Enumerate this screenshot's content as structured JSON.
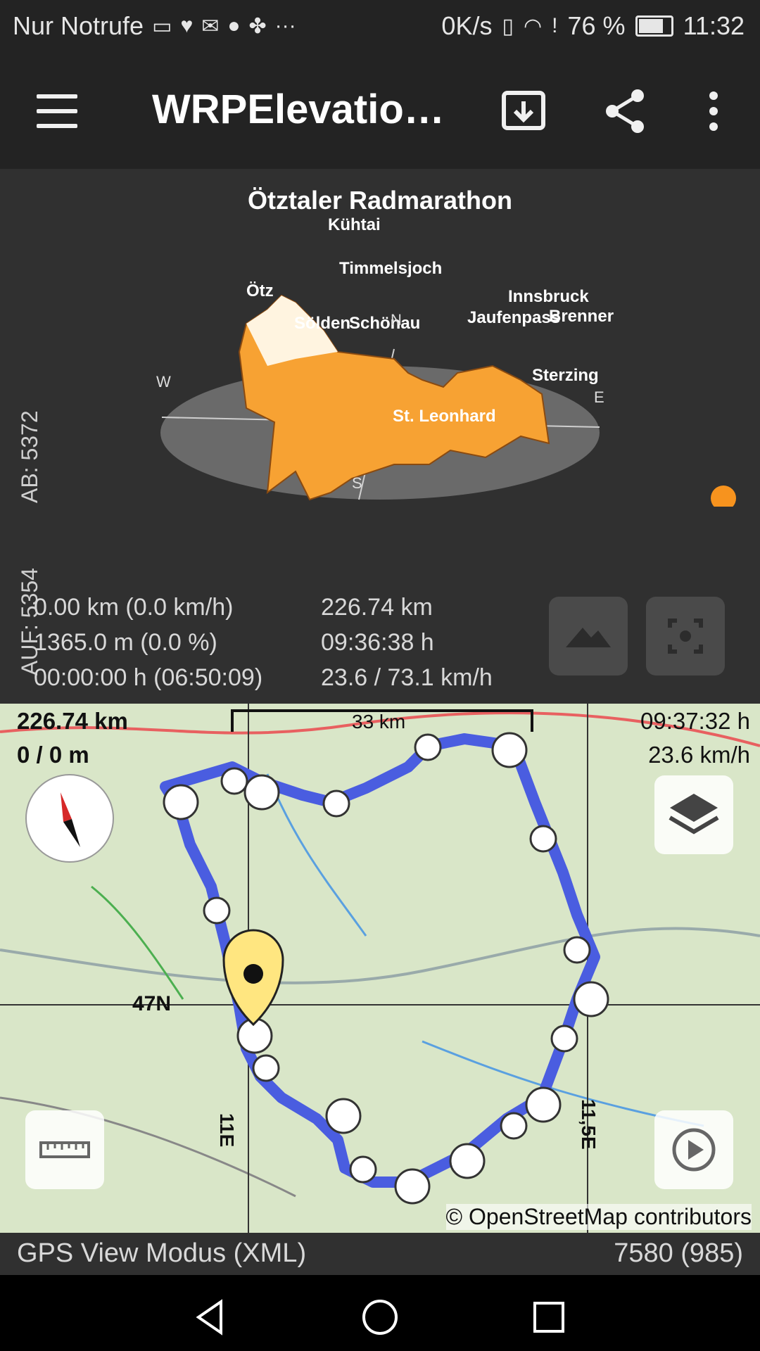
{
  "statusbar": {
    "carrier": "Nur Notrufe",
    "speed": "0K/s",
    "battery": "76 %",
    "time": "11:32"
  },
  "app": {
    "title": "WRPElevation..."
  },
  "profile": {
    "title": "Ötztaler Radmarathon",
    "auf": "AUF: 5354",
    "ab": "AB: 5372",
    "places": [
      {
        "name": "Kühtai"
      },
      {
        "name": "Timmelsjoch"
      },
      {
        "name": "Ötz"
      },
      {
        "name": "Innsbruck"
      },
      {
        "name": "Jaufenpass"
      },
      {
        "name": "Brenner"
      },
      {
        "name": "Sölden"
      },
      {
        "name": "Schönau"
      },
      {
        "name": "Sterzing"
      },
      {
        "name": "St. Leonhard"
      }
    ],
    "compass": {
      "w": "W",
      "e": "E",
      "n": "N",
      "s": "S"
    },
    "stats_left": [
      "0.00 km (0.0 km/h)",
      "1365.0 m (0.0 %)",
      "00:00:00 h (06:50:09)"
    ],
    "stats_right": [
      "226.74 km",
      "09:36:38 h",
      "23.6 / 73.1 km/h"
    ],
    "accent": "#f7931e"
  },
  "map": {
    "distance": "226.74 km",
    "elevation": "0 / 0 m",
    "time": "09:37:32 h",
    "speed": "23.6 km/h",
    "scale": "33 km",
    "lat_label": "47N",
    "lon1": "11E",
    "lon2": "11,5E",
    "attribution": "© OpenStreetMap contributors",
    "route_color": "#4a5de0"
  },
  "footer": {
    "mode": "GPS View Modus (XML)",
    "count": "7580 (985)"
  }
}
